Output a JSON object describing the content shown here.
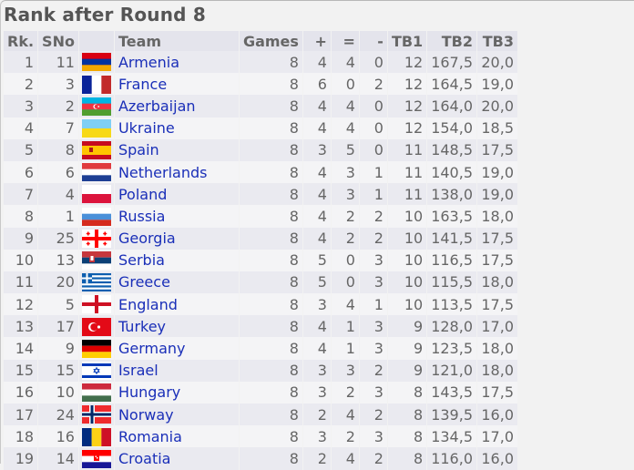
{
  "page": {
    "title": "Rank after Round 8"
  },
  "table": {
    "headers": {
      "rank": "Rk.",
      "sno": "SNo",
      "flag": "",
      "team": "Team",
      "games": "Games",
      "wins": "+",
      "draws": "=",
      "losses": "-",
      "tb1": "TB1",
      "tb2": "TB2",
      "tb3": "TB3"
    },
    "rows": [
      {
        "rank": "1",
        "sno": "11",
        "flag": "armenia-flag",
        "team": "Armenia",
        "games": "8",
        "wins": "4",
        "draws": "4",
        "losses": "0",
        "tb1": "12",
        "tb2": "167,5",
        "tb3": "20,0"
      },
      {
        "rank": "2",
        "sno": "3",
        "flag": "france-flag",
        "team": "France",
        "games": "8",
        "wins": "6",
        "draws": "0",
        "losses": "2",
        "tb1": "12",
        "tb2": "164,5",
        "tb3": "19,0"
      },
      {
        "rank": "3",
        "sno": "2",
        "flag": "azerbaijan-flag",
        "team": "Azerbaijan",
        "games": "8",
        "wins": "4",
        "draws": "4",
        "losses": "0",
        "tb1": "12",
        "tb2": "164,0",
        "tb3": "20,0"
      },
      {
        "rank": "4",
        "sno": "7",
        "flag": "ukraine-flag",
        "team": "Ukraine",
        "games": "8",
        "wins": "4",
        "draws": "4",
        "losses": "0",
        "tb1": "12",
        "tb2": "154,0",
        "tb3": "18,5"
      },
      {
        "rank": "5",
        "sno": "8",
        "flag": "spain-flag",
        "team": "Spain",
        "games": "8",
        "wins": "3",
        "draws": "5",
        "losses": "0",
        "tb1": "11",
        "tb2": "148,5",
        "tb3": "17,5"
      },
      {
        "rank": "6",
        "sno": "6",
        "flag": "netherlands-flag",
        "team": "Netherlands",
        "games": "8",
        "wins": "4",
        "draws": "3",
        "losses": "1",
        "tb1": "11",
        "tb2": "140,5",
        "tb3": "19,0"
      },
      {
        "rank": "7",
        "sno": "4",
        "flag": "poland-flag",
        "team": "Poland",
        "games": "8",
        "wins": "4",
        "draws": "3",
        "losses": "1",
        "tb1": "11",
        "tb2": "138,0",
        "tb3": "19,0"
      },
      {
        "rank": "8",
        "sno": "1",
        "flag": "russia-flag",
        "team": "Russia",
        "games": "8",
        "wins": "4",
        "draws": "2",
        "losses": "2",
        "tb1": "10",
        "tb2": "163,5",
        "tb3": "18,0"
      },
      {
        "rank": "9",
        "sno": "25",
        "flag": "georgia-flag",
        "team": "Georgia",
        "games": "8",
        "wins": "4",
        "draws": "2",
        "losses": "2",
        "tb1": "10",
        "tb2": "141,5",
        "tb3": "17,5"
      },
      {
        "rank": "10",
        "sno": "13",
        "flag": "serbia-flag",
        "team": "Serbia",
        "games": "8",
        "wins": "5",
        "draws": "0",
        "losses": "3",
        "tb1": "10",
        "tb2": "116,5",
        "tb3": "17,5"
      },
      {
        "rank": "11",
        "sno": "20",
        "flag": "greece-flag",
        "team": "Greece",
        "games": "8",
        "wins": "5",
        "draws": "0",
        "losses": "3",
        "tb1": "10",
        "tb2": "115,5",
        "tb3": "18,0"
      },
      {
        "rank": "12",
        "sno": "5",
        "flag": "england-flag",
        "team": "England",
        "games": "8",
        "wins": "3",
        "draws": "4",
        "losses": "1",
        "tb1": "10",
        "tb2": "113,5",
        "tb3": "17,5"
      },
      {
        "rank": "13",
        "sno": "17",
        "flag": "turkey-flag",
        "team": "Turkey",
        "games": "8",
        "wins": "4",
        "draws": "1",
        "losses": "3",
        "tb1": "9",
        "tb2": "128,0",
        "tb3": "17,0"
      },
      {
        "rank": "14",
        "sno": "9",
        "flag": "germany-flag",
        "team": "Germany",
        "games": "8",
        "wins": "4",
        "draws": "1",
        "losses": "3",
        "tb1": "9",
        "tb2": "123,5",
        "tb3": "18,0"
      },
      {
        "rank": "15",
        "sno": "15",
        "flag": "israel-flag",
        "team": "Israel",
        "games": "8",
        "wins": "3",
        "draws": "3",
        "losses": "2",
        "tb1": "9",
        "tb2": "121,0",
        "tb3": "18,0"
      },
      {
        "rank": "16",
        "sno": "10",
        "flag": "hungary-flag",
        "team": "Hungary",
        "games": "8",
        "wins": "3",
        "draws": "2",
        "losses": "3",
        "tb1": "8",
        "tb2": "143,5",
        "tb3": "17,5"
      },
      {
        "rank": "17",
        "sno": "24",
        "flag": "norway-flag",
        "team": "Norway",
        "games": "8",
        "wins": "2",
        "draws": "4",
        "losses": "2",
        "tb1": "8",
        "tb2": "139,5",
        "tb3": "16,0"
      },
      {
        "rank": "18",
        "sno": "16",
        "flag": "romania-flag",
        "team": "Romania",
        "games": "8",
        "wins": "3",
        "draws": "2",
        "losses": "3",
        "tb1": "8",
        "tb2": "134,5",
        "tb3": "17,0"
      },
      {
        "rank": "19",
        "sno": "14",
        "flag": "croatia-flag",
        "team": "Croatia",
        "games": "8",
        "wins": "2",
        "draws": "4",
        "losses": "2",
        "tb1": "8",
        "tb2": "116,0",
        "tb3": "16,0"
      }
    ]
  },
  "colors": {
    "link": "#1a2fb8",
    "header_bg": "#e4e4ec",
    "row_odd": "#eaeaf0",
    "row_even": "#f4f4f6",
    "text": "#666666",
    "title": "#555555"
  }
}
